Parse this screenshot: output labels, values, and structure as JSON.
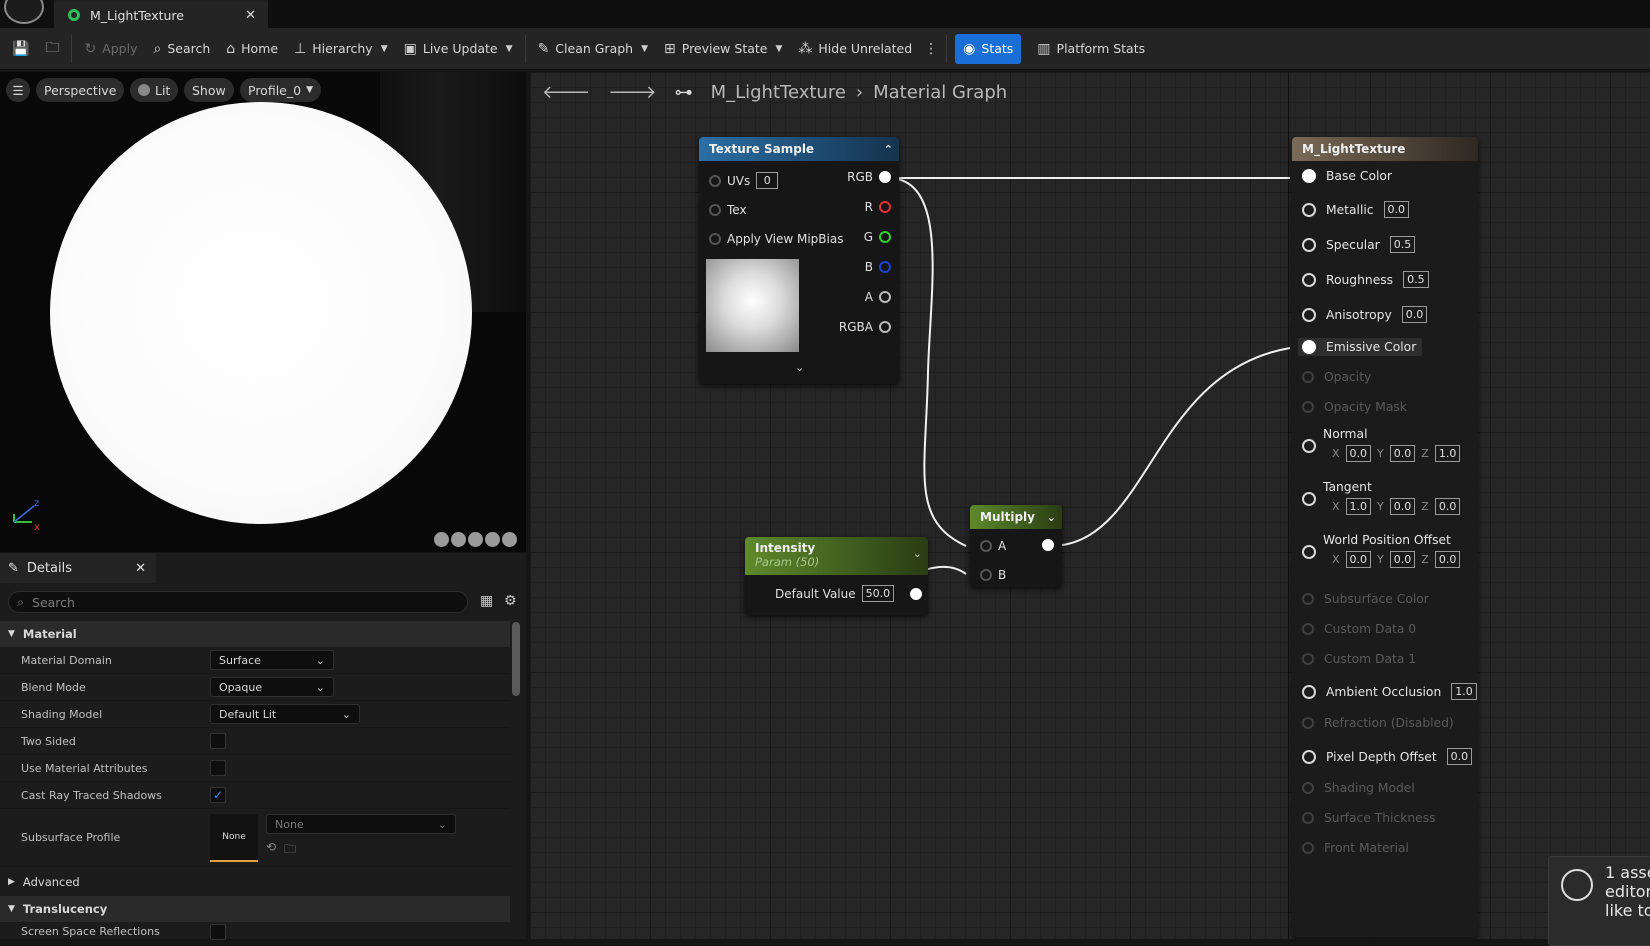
{
  "tab": {
    "title": "M_LightTexture"
  },
  "toolbar": {
    "apply": "Apply",
    "search": "Search",
    "home": "Home",
    "hierarchy": "Hierarchy",
    "live_update": "Live Update",
    "clean_graph": "Clean Graph",
    "preview_state": "Preview State",
    "hide_unrelated": "Hide Unrelated",
    "stats": "Stats",
    "platform_stats": "Platform Stats"
  },
  "viewport": {
    "perspective": "Perspective",
    "lit": "Lit",
    "show": "Show",
    "profile": "Profile_0",
    "axis_z": "z",
    "axis_x": "x"
  },
  "details": {
    "tab": "Details",
    "search_placeholder": "Search",
    "category_material": "Material",
    "rows": [
      {
        "label": "Material Domain",
        "value": "Surface"
      },
      {
        "label": "Blend Mode",
        "value": "Opaque"
      },
      {
        "label": "Shading Model",
        "value": "Default Lit"
      },
      {
        "label": "Two Sided",
        "checked": false
      },
      {
        "label": "Use Material Attributes",
        "checked": false
      },
      {
        "label": "Cast Ray Traced Shadows",
        "checked": true
      }
    ],
    "subsurface_label": "Subsurface Profile",
    "subsurface_thumb": "None",
    "subsurface_value": "None",
    "category_advanced": "Advanced",
    "category_translucency": "Translucency",
    "ssr_label": "Screen Space Reflections"
  },
  "graph": {
    "breadcrumb_root": "M_LightTexture",
    "breadcrumb_child": "Material Graph",
    "texture_node": {
      "title": "Texture Sample",
      "uvs": "UVs",
      "uvs_value": "0",
      "tex": "Tex",
      "mip": "Apply View MipBias",
      "rgb": "RGB",
      "r": "R",
      "g": "G",
      "b": "B",
      "a": "A",
      "rgba": "RGBA"
    },
    "intensity_node": {
      "title": "Intensity",
      "subtitle": "Param (50)",
      "default_label": "Default Value",
      "default_value": "50.0"
    },
    "multiply_node": {
      "title": "Multiply",
      "a": "A",
      "b": "B"
    },
    "result_node": {
      "title": "M_LightTexture",
      "base_color": "Base Color",
      "metallic": "Metallic",
      "metallic_value": "0.0",
      "specular": "Specular",
      "specular_value": "0.5",
      "roughness": "Roughness",
      "roughness_value": "0.5",
      "anisotropy": "Anisotropy",
      "anisotropy_value": "0.0",
      "emissive": "Emissive Color",
      "opacity": "Opacity",
      "opacity_mask": "Opacity Mask",
      "normal": "Normal",
      "normal_x": "0.0",
      "normal_y": "0.0",
      "normal_z": "1.0",
      "tangent": "Tangent",
      "tangent_x": "1.0",
      "tangent_y": "0.0",
      "tangent_z": "0.0",
      "wpo": "World Position Offset",
      "wpo_x": "0.0",
      "wpo_y": "0.0",
      "wpo_z": "0.0",
      "subsurface": "Subsurface Color",
      "cd0": "Custom Data 0",
      "cd1": "Custom Data 1",
      "ao": "Ambient Occlusion",
      "ao_value": "1.0",
      "refraction": "Refraction (Disabled)",
      "pdo": "Pixel Depth Offset",
      "pdo_value": "0.0",
      "shading_model": "Shading Model",
      "surface_thickness": "Surface Thickness",
      "front_material": "Front Material",
      "axis_x": "X",
      "axis_y": "Y",
      "axis_z": "Z"
    }
  },
  "toast": {
    "line1": "1 asse",
    "line2": "editor",
    "line3": "like to"
  }
}
